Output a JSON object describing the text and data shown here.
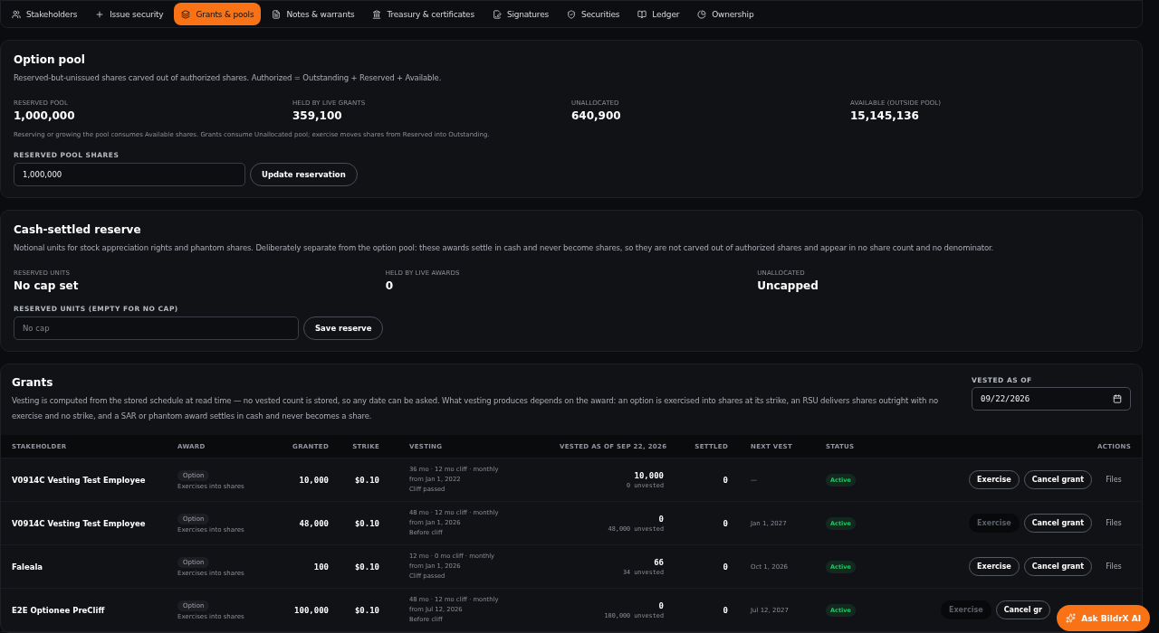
{
  "nav": {
    "tabs": [
      {
        "label": "Stakeholders",
        "selected": false
      },
      {
        "label": "Issue security",
        "selected": false
      },
      {
        "label": "Grants & pools",
        "selected": true
      },
      {
        "label": "Notes & warrants",
        "selected": false
      },
      {
        "label": "Treasury & certificates",
        "selected": false
      },
      {
        "label": "Signatures",
        "selected": false
      },
      {
        "label": "Securities",
        "selected": false
      },
      {
        "label": "Ledger",
        "selected": false
      },
      {
        "label": "Ownership",
        "selected": false
      }
    ]
  },
  "option_pool": {
    "title": "Option pool",
    "description": "Reserved-but-unissued shares carved out of authorized shares. Authorized = Outstanding + Reserved + Available.",
    "stats": [
      {
        "label": "RESERVED POOL",
        "value": "1,000,000"
      },
      {
        "label": "HELD BY LIVE GRANTS",
        "value": "359,100"
      },
      {
        "label": "UNALLOCATED",
        "value": "640,900"
      },
      {
        "label": "AVAILABLE (OUTSIDE POOL)",
        "value": "15,145,136"
      }
    ],
    "note": "Reserving or growing the pool consumes Available shares. Grants consume Unallocated pool; exercise moves shares from Reserved into Outstanding.",
    "field_label": "RESERVED POOL SHARES",
    "field_value": "1,000,000",
    "button": "Update reservation"
  },
  "cash_reserve": {
    "title": "Cash-settled reserve",
    "description": "Notional units for stock appreciation rights and phantom shares. Deliberately separate from the option pool: these awards settle in cash and never become shares, so they are not carved out of authorized shares and appear in no share count and no denominator.",
    "stats": [
      {
        "label": "RESERVED UNITS",
        "value": "No cap set"
      },
      {
        "label": "HELD BY LIVE AWARDS",
        "value": "0"
      },
      {
        "label": "UNALLOCATED",
        "value": "Uncapped"
      }
    ],
    "field_label": "RESERVED UNITS (EMPTY FOR NO CAP)",
    "placeholder": "No cap",
    "button": "Save reserve"
  },
  "grants": {
    "title": "Grants",
    "description": "Vesting is computed from the stored schedule at read time — no vested count is stored, so any date can be asked. What vesting produces depends on the award: an option is exercised into shares at its strike, an RSU delivers shares outright with no exercise and no strike, and a SAR or phantom award settles in cash and never becomes a share.",
    "date_label": "VESTED AS OF",
    "date_value": "09/22/2026",
    "columns": [
      "STAKEHOLDER",
      "AWARD",
      "GRANTED",
      "STRIKE",
      "VESTING",
      "VESTED AS OF SEP 22, 2026",
      "SETTLED",
      "NEXT VEST",
      "STATUS",
      "ACTIONS"
    ],
    "rows": [
      {
        "stakeholder": "V0914C Vesting Test Employee",
        "award": "Option",
        "award_note": "Exercises into shares",
        "granted": "10,000",
        "strike": "$0.10",
        "vesting": [
          "36 mo · 12 mo cliff · monthly",
          "from Jan 1, 2022",
          "Cliff passed"
        ],
        "vested": "10,000",
        "unvested": "0 unvested",
        "settled": "0",
        "next_vest": "—",
        "status": "Active",
        "exercise": "Exercise",
        "exercise_disabled": false,
        "cancel": "Cancel grant",
        "files": "Files"
      },
      {
        "stakeholder": "V0914C Vesting Test Employee",
        "award": "Option",
        "award_note": "Exercises into shares",
        "granted": "48,000",
        "strike": "$0.10",
        "vesting": [
          "48 mo · 12 mo cliff · monthly",
          "from Jan 1, 2026",
          "Before cliff"
        ],
        "vested": "0",
        "unvested": "48,000 unvested",
        "settled": "0",
        "next_vest": "Jan 1, 2027",
        "status": "Active",
        "exercise": "Exercise",
        "exercise_disabled": true,
        "cancel": "Cancel grant",
        "files": "Files"
      },
      {
        "stakeholder": "Faleala",
        "award": "Option",
        "award_note": "Exercises into shares",
        "granted": "100",
        "strike": "$0.10",
        "vesting": [
          "12 mo · 0 mo cliff · monthly",
          "from Jan 1, 2026",
          "Cliff passed"
        ],
        "vested": "66",
        "unvested": "34 unvested",
        "settled": "0",
        "next_vest": "Oct 1, 2026",
        "status": "Active",
        "exercise": "Exercise",
        "exercise_disabled": false,
        "cancel": "Cancel grant",
        "files": "Files"
      },
      {
        "stakeholder": "E2E Optionee PreCliff",
        "award": "Option",
        "award_note": "Exercises into shares",
        "granted": "100,000",
        "strike": "$0.10",
        "vesting": [
          "48 mo · 12 mo cliff · monthly",
          "from Jul 12, 2026",
          "Before cliff"
        ],
        "vested": "0",
        "unvested": "100,000 unvested",
        "settled": "0",
        "next_vest": "Jul 12, 2027",
        "status": "Active",
        "exercise": "Exercise",
        "exercise_disabled": true,
        "cancel": "Cancel gr"
      }
    ]
  },
  "assistant_button": "Ask BildrX AI"
}
